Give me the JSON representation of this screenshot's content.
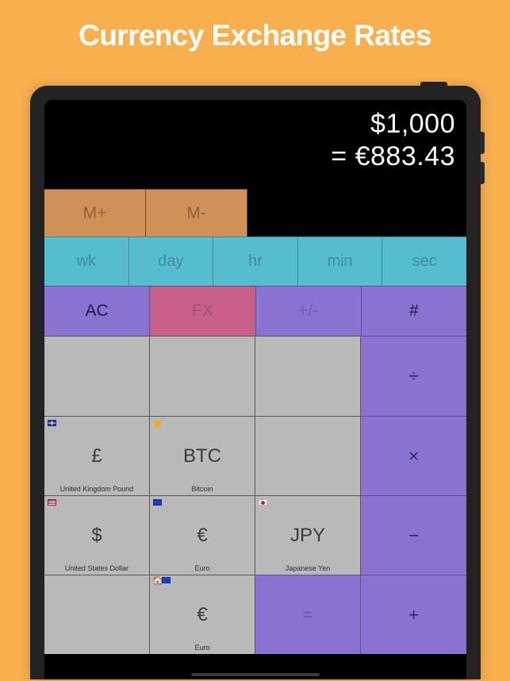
{
  "page": {
    "title": "Currency Exchange Rates",
    "background_color": "#f8b04f",
    "title_color": "#ffffff"
  },
  "device": {
    "name": "tablet-frame",
    "bezel_color": "#232323",
    "buttons": [
      "power-button",
      "volume-up-button",
      "volume-down-button"
    ]
  },
  "display": {
    "input_value": "$1,000",
    "result_value": "= €883.43",
    "background_color": "#000000",
    "text_color": "#ffffff"
  },
  "memory_row": {
    "color": "#cf9158",
    "keys": [
      {
        "label": "M+",
        "name": "memory-plus-key"
      },
      {
        "label": "M-",
        "name": "memory-minus-key"
      }
    ]
  },
  "time_row": {
    "color": "#55bdcd",
    "keys": [
      {
        "label": "wk",
        "name": "time-week-key"
      },
      {
        "label": "day",
        "name": "time-day-key"
      },
      {
        "label": "hr",
        "name": "time-hour-key"
      },
      {
        "label": "min",
        "name": "time-minute-key"
      },
      {
        "label": "sec",
        "name": "time-second-key"
      }
    ]
  },
  "function_row": {
    "color": "#8a72d0",
    "fx_color": "#c75f8a",
    "keys": [
      {
        "label": "AC",
        "name": "all-clear-key"
      },
      {
        "label": "FX",
        "name": "fx-key"
      },
      {
        "label": "+/-",
        "name": "sign-toggle-key"
      },
      {
        "label": "#",
        "name": "hash-key"
      }
    ]
  },
  "keypad": {
    "cell_color": "#b9b9b9",
    "operator_color": "#8a72d0",
    "rows": [
      [
        {
          "symbol": "",
          "currency_name": "",
          "icon": "",
          "name": "empty-key-1"
        },
        {
          "symbol": "",
          "currency_name": "",
          "icon": "",
          "name": "empty-key-2"
        },
        {
          "symbol": "",
          "currency_name": "",
          "icon": "",
          "name": "empty-key-3"
        },
        {
          "symbol": "÷",
          "currency_name": "",
          "icon": "",
          "name": "divide-key"
        }
      ],
      [
        {
          "symbol": "£",
          "currency_name": "United Kingdom Pound",
          "icon": "uk-flag-icon",
          "name": "currency-key-gbp"
        },
        {
          "symbol": "BTC",
          "currency_name": "Bitcoin",
          "icon": "bitcoin-icon",
          "name": "currency-key-btc"
        },
        {
          "symbol": "",
          "currency_name": "",
          "icon": "",
          "name": "empty-key-4"
        },
        {
          "symbol": "×",
          "currency_name": "",
          "icon": "",
          "name": "multiply-key"
        }
      ],
      [
        {
          "symbol": "$",
          "currency_name": "United States Dollar",
          "icon": "us-flag-icon",
          "name": "currency-key-usd"
        },
        {
          "symbol": "€",
          "currency_name": "Euro",
          "icon": "eu-flag-icon",
          "name": "currency-key-eur"
        },
        {
          "symbol": "JPY",
          "currency_name": "Japanese Yen",
          "icon": "japan-flag-icon",
          "name": "currency-key-jpy"
        },
        {
          "symbol": "−",
          "currency_name": "",
          "icon": "",
          "name": "minus-key"
        }
      ],
      [
        {
          "symbol": "",
          "currency_name": "",
          "icon": "",
          "name": "empty-key-5"
        },
        {
          "symbol": "€",
          "currency_name": "Euro",
          "icon": "home-currency-icon",
          "name": "home-currency-key-eur"
        },
        {
          "symbol": "=",
          "currency_name": "",
          "icon": "",
          "name": "equals-key"
        },
        {
          "symbol": "+",
          "currency_name": "",
          "icon": "",
          "name": "plus-key"
        }
      ]
    ]
  }
}
